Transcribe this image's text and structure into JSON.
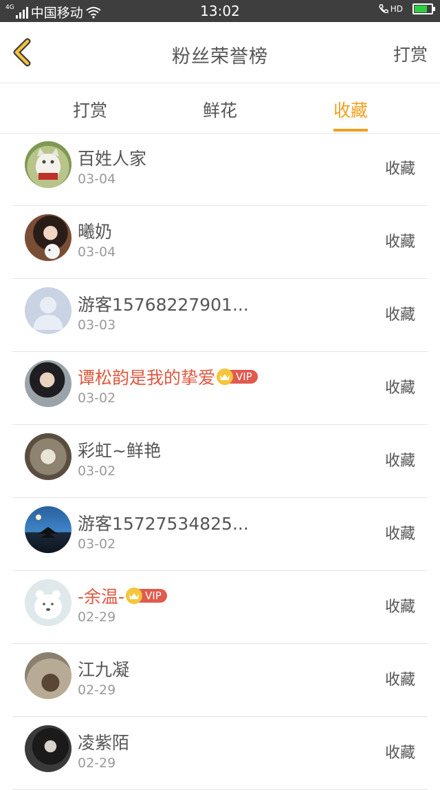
{
  "status_bar": {
    "network": "4G",
    "carrier": "中国移动",
    "time": "13:02",
    "hd_label": "HD"
  },
  "header": {
    "title": "粉丝荣誉榜",
    "action": "打赏"
  },
  "tabs": [
    {
      "label": "打赏",
      "active": false
    },
    {
      "label": "鲜花",
      "active": false
    },
    {
      "label": "收藏",
      "active": true
    }
  ],
  "accent_color": "#f0a01e",
  "vip_label": "VIP",
  "fans": [
    {
      "name": "百姓人家",
      "date": "03-04",
      "action": "收藏",
      "vip": false
    },
    {
      "name": "曦奶",
      "date": "03-04",
      "action": "收藏",
      "vip": false
    },
    {
      "name": "游客15768227901...",
      "date": "03-03",
      "action": "收藏",
      "vip": false
    },
    {
      "name": "谭松韵是我的挚爱",
      "date": "03-02",
      "action": "收藏",
      "vip": true
    },
    {
      "name": "彩虹~鲜艳",
      "date": "03-02",
      "action": "收藏",
      "vip": false
    },
    {
      "name": "游客15727534825...",
      "date": "03-02",
      "action": "收藏",
      "vip": false
    },
    {
      "name": "-余温-",
      "date": "02-29",
      "action": "收藏",
      "vip": true
    },
    {
      "name": "江九凝",
      "date": "02-29",
      "action": "收藏",
      "vip": false
    },
    {
      "name": "凌紫陌",
      "date": "02-29",
      "action": "收藏",
      "vip": false
    }
  ]
}
